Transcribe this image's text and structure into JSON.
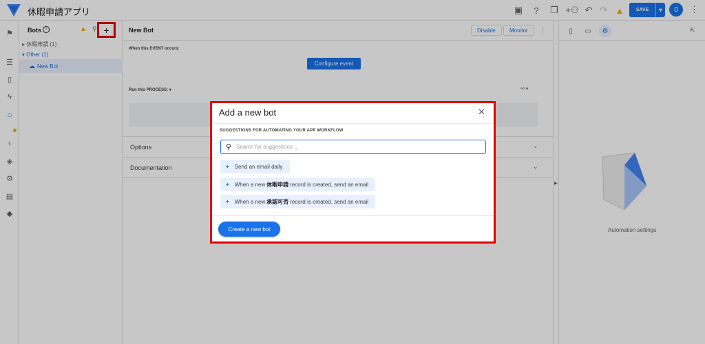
{
  "app": {
    "title": "休暇申請アプリ"
  },
  "topbar": {
    "save_label": "SAVE",
    "avatar_initial": "0"
  },
  "bots_panel": {
    "title": "Bots",
    "add_label": "+",
    "tree": [
      {
        "label": "休暇申請 (1)",
        "expanded": false
      },
      {
        "label": "Other (1)",
        "expanded": true
      },
      {
        "label": "New Bot",
        "selected": true
      }
    ]
  },
  "main": {
    "title": "New Bot",
    "disable_label": "Disable",
    "monitor_label": "Monitor",
    "event_label": "When this EVENT occurs:",
    "configure_label": "Configure event",
    "process_label": "Run this PROCESS:",
    "options_label": "Options",
    "documentation_label": "Documentation"
  },
  "right_panel": {
    "label": "Automation settings"
  },
  "modal": {
    "title": "Add a new bot",
    "section_title": "SUGGESTIONS FOR AUTOMATING YOUR APP WORKFLOW",
    "search_placeholder": "Search for suggestions ...",
    "suggestions": [
      {
        "text": "Send an email daily"
      },
      {
        "prefix": "When a new",
        "table": "休暇申請",
        "suffix": "record is created, send an email"
      },
      {
        "prefix": "When a new",
        "table": "承認可否",
        "suffix": "record is created, send an email"
      }
    ],
    "create_label": "Create a new bot"
  },
  "colors": {
    "accent": "#1a73e8",
    "highlight": "#e00000",
    "warning": "#f9ab00"
  }
}
